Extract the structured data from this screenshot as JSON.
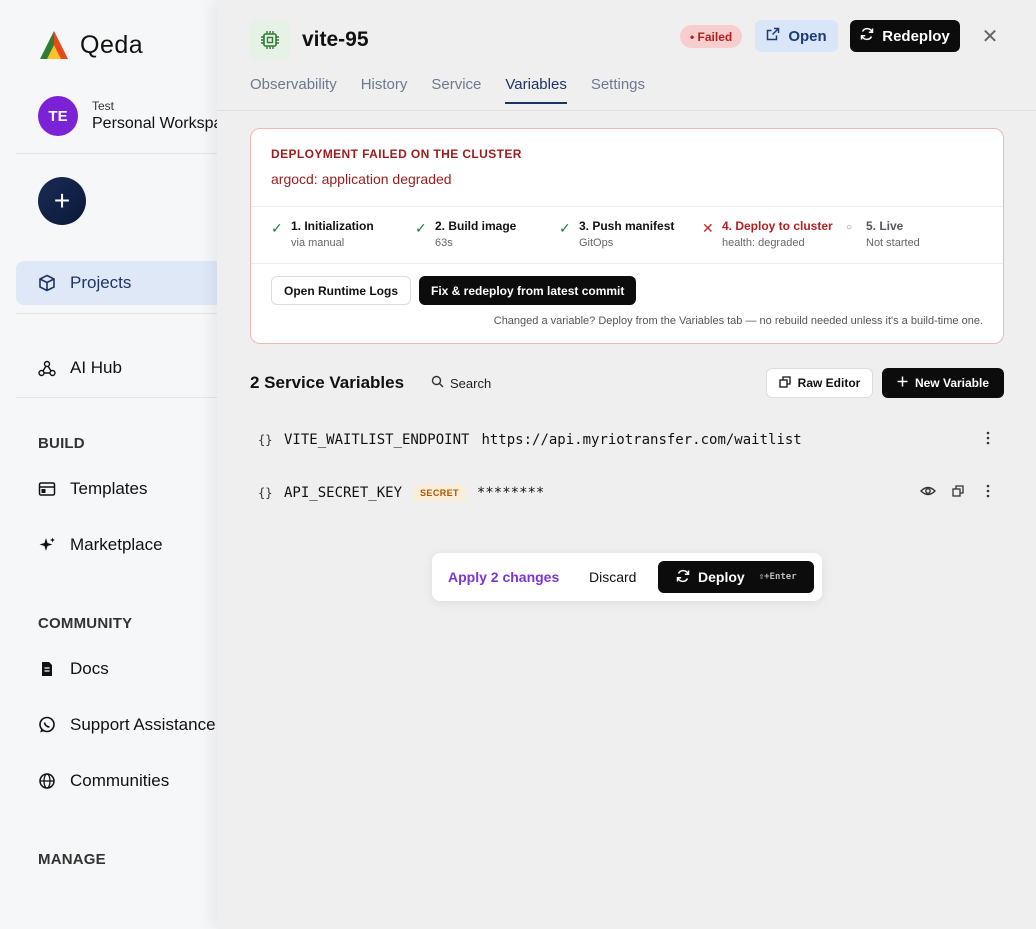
{
  "app": {
    "name": "Qeda"
  },
  "workspace": {
    "label": "Test",
    "name": "Personal Workspace",
    "initials": "TE"
  },
  "sidebar": {
    "projects": "Projects",
    "ai_hub": "AI Hub",
    "build_title": "BUILD",
    "templates": "Templates",
    "marketplace": "Marketplace",
    "community_title": "COMMUNITY",
    "docs": "Docs",
    "support": "Support Assistance",
    "communities": "Communities",
    "manage_title": "MANAGE"
  },
  "service": {
    "name": "vite-95",
    "status": "• Failed",
    "open_label": "Open",
    "redeploy_label": "Redeploy"
  },
  "tabs": [
    "Observability",
    "History",
    "Service",
    "Variables",
    "Settings"
  ],
  "active_tab": "Variables",
  "error": {
    "title": "DEPLOYMENT FAILED ON THE CLUSTER",
    "message": "argocd: application degraded",
    "steps": [
      {
        "title": "1. Initialization",
        "sub": "via manual",
        "state": "ok",
        "mark": "✓"
      },
      {
        "title": "2. Build image",
        "sub": "63s",
        "state": "ok",
        "mark": "✓"
      },
      {
        "title": "3. Push manifest",
        "sub": "GitOps",
        "state": "ok",
        "mark": "✓"
      },
      {
        "title": "4. Deploy to cluster",
        "sub": "health: degraded",
        "state": "fail",
        "mark": "✕"
      },
      {
        "title": "5. Live",
        "sub": "Not started",
        "state": "pending",
        "mark": "○"
      }
    ],
    "logs_button": "Open Runtime Logs",
    "fix_button": "Fix & redeploy from latest commit",
    "hint": "Changed a variable? Deploy from the Variables tab — no rebuild needed unless it's a build-time one."
  },
  "variables": {
    "title": "2 Service Variables",
    "search_label": "Search",
    "raw_editor_label": "Raw Editor",
    "new_variable_label": "New Variable",
    "items": [
      {
        "name": "VITE_WAITLIST_ENDPOINT",
        "value": "https://api.myriotransfer.com/waitlist",
        "secret": false
      },
      {
        "name": "API_SECRET_KEY",
        "value": "********",
        "secret": true,
        "secret_label": "SECRET"
      }
    ]
  },
  "changes": {
    "apply_label": "Apply 2 changes",
    "discard_label": "Discard",
    "deploy_label": "Deploy",
    "shortcut": "⇧+Enter"
  },
  "colors": {
    "accent": "#1d3463",
    "danger": "#b32020",
    "success": "#1e7a36",
    "purple": "#7b35d6",
    "avatar": "#7b22d6"
  }
}
